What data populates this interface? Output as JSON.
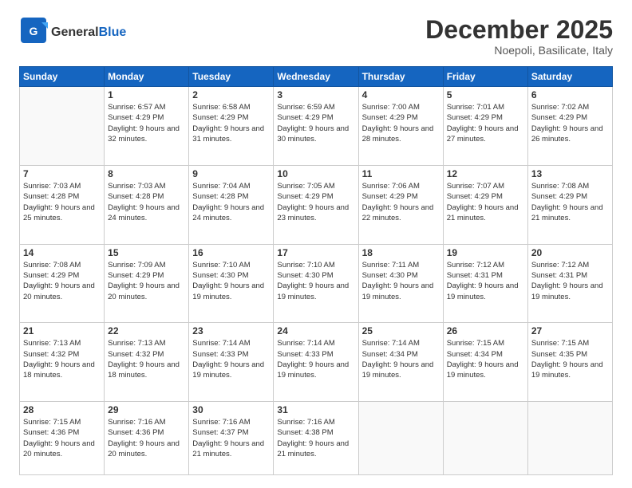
{
  "header": {
    "logo_general": "General",
    "logo_blue": "Blue",
    "month_title": "December 2025",
    "location": "Noepoli, Basilicate, Italy"
  },
  "days_of_week": [
    "Sunday",
    "Monday",
    "Tuesday",
    "Wednesday",
    "Thursday",
    "Friday",
    "Saturday"
  ],
  "weeks": [
    [
      {
        "day": "",
        "info": ""
      },
      {
        "day": "1",
        "info": "Sunrise: 6:57 AM\nSunset: 4:29 PM\nDaylight: 9 hours\nand 32 minutes."
      },
      {
        "day": "2",
        "info": "Sunrise: 6:58 AM\nSunset: 4:29 PM\nDaylight: 9 hours\nand 31 minutes."
      },
      {
        "day": "3",
        "info": "Sunrise: 6:59 AM\nSunset: 4:29 PM\nDaylight: 9 hours\nand 30 minutes."
      },
      {
        "day": "4",
        "info": "Sunrise: 7:00 AM\nSunset: 4:29 PM\nDaylight: 9 hours\nand 28 minutes."
      },
      {
        "day": "5",
        "info": "Sunrise: 7:01 AM\nSunset: 4:29 PM\nDaylight: 9 hours\nand 27 minutes."
      },
      {
        "day": "6",
        "info": "Sunrise: 7:02 AM\nSunset: 4:29 PM\nDaylight: 9 hours\nand 26 minutes."
      }
    ],
    [
      {
        "day": "7",
        "info": "Sunrise: 7:03 AM\nSunset: 4:28 PM\nDaylight: 9 hours\nand 25 minutes."
      },
      {
        "day": "8",
        "info": "Sunrise: 7:03 AM\nSunset: 4:28 PM\nDaylight: 9 hours\nand 24 minutes."
      },
      {
        "day": "9",
        "info": "Sunrise: 7:04 AM\nSunset: 4:28 PM\nDaylight: 9 hours\nand 24 minutes."
      },
      {
        "day": "10",
        "info": "Sunrise: 7:05 AM\nSunset: 4:29 PM\nDaylight: 9 hours\nand 23 minutes."
      },
      {
        "day": "11",
        "info": "Sunrise: 7:06 AM\nSunset: 4:29 PM\nDaylight: 9 hours\nand 22 minutes."
      },
      {
        "day": "12",
        "info": "Sunrise: 7:07 AM\nSunset: 4:29 PM\nDaylight: 9 hours\nand 21 minutes."
      },
      {
        "day": "13",
        "info": "Sunrise: 7:08 AM\nSunset: 4:29 PM\nDaylight: 9 hours\nand 21 minutes."
      }
    ],
    [
      {
        "day": "14",
        "info": "Sunrise: 7:08 AM\nSunset: 4:29 PM\nDaylight: 9 hours\nand 20 minutes."
      },
      {
        "day": "15",
        "info": "Sunrise: 7:09 AM\nSunset: 4:29 PM\nDaylight: 9 hours\nand 20 minutes."
      },
      {
        "day": "16",
        "info": "Sunrise: 7:10 AM\nSunset: 4:30 PM\nDaylight: 9 hours\nand 19 minutes."
      },
      {
        "day": "17",
        "info": "Sunrise: 7:10 AM\nSunset: 4:30 PM\nDaylight: 9 hours\nand 19 minutes."
      },
      {
        "day": "18",
        "info": "Sunrise: 7:11 AM\nSunset: 4:30 PM\nDaylight: 9 hours\nand 19 minutes."
      },
      {
        "day": "19",
        "info": "Sunrise: 7:12 AM\nSunset: 4:31 PM\nDaylight: 9 hours\nand 19 minutes."
      },
      {
        "day": "20",
        "info": "Sunrise: 7:12 AM\nSunset: 4:31 PM\nDaylight: 9 hours\nand 19 minutes."
      }
    ],
    [
      {
        "day": "21",
        "info": "Sunrise: 7:13 AM\nSunset: 4:32 PM\nDaylight: 9 hours\nand 18 minutes."
      },
      {
        "day": "22",
        "info": "Sunrise: 7:13 AM\nSunset: 4:32 PM\nDaylight: 9 hours\nand 18 minutes."
      },
      {
        "day": "23",
        "info": "Sunrise: 7:14 AM\nSunset: 4:33 PM\nDaylight: 9 hours\nand 19 minutes."
      },
      {
        "day": "24",
        "info": "Sunrise: 7:14 AM\nSunset: 4:33 PM\nDaylight: 9 hours\nand 19 minutes."
      },
      {
        "day": "25",
        "info": "Sunrise: 7:14 AM\nSunset: 4:34 PM\nDaylight: 9 hours\nand 19 minutes."
      },
      {
        "day": "26",
        "info": "Sunrise: 7:15 AM\nSunset: 4:34 PM\nDaylight: 9 hours\nand 19 minutes."
      },
      {
        "day": "27",
        "info": "Sunrise: 7:15 AM\nSunset: 4:35 PM\nDaylight: 9 hours\nand 19 minutes."
      }
    ],
    [
      {
        "day": "28",
        "info": "Sunrise: 7:15 AM\nSunset: 4:36 PM\nDaylight: 9 hours\nand 20 minutes."
      },
      {
        "day": "29",
        "info": "Sunrise: 7:16 AM\nSunset: 4:36 PM\nDaylight: 9 hours\nand 20 minutes."
      },
      {
        "day": "30",
        "info": "Sunrise: 7:16 AM\nSunset: 4:37 PM\nDaylight: 9 hours\nand 21 minutes."
      },
      {
        "day": "31",
        "info": "Sunrise: 7:16 AM\nSunset: 4:38 PM\nDaylight: 9 hours\nand 21 minutes."
      },
      {
        "day": "",
        "info": ""
      },
      {
        "day": "",
        "info": ""
      },
      {
        "day": "",
        "info": ""
      }
    ]
  ]
}
